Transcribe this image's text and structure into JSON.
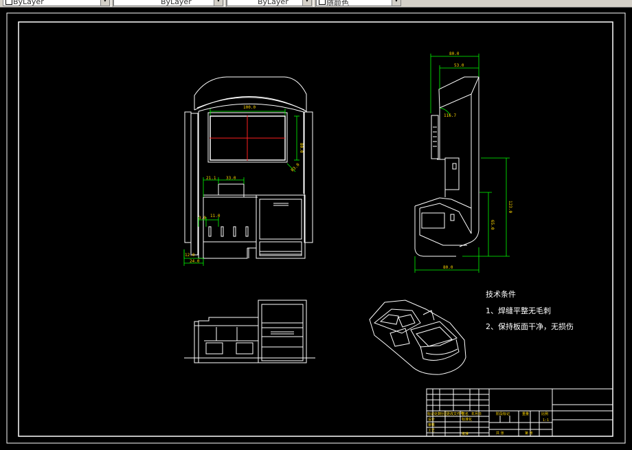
{
  "toolbar": {
    "linetype_value": "ByLayer",
    "lineweight_value": "ByLayer",
    "plotstyle_value": "ByLayer",
    "color_value": "随颜色"
  },
  "dims": {
    "front_width": "100.0",
    "front_height": "80.0",
    "front_chamfer": "R3.0",
    "front_d1": "21.1",
    "front_d2": "33.0",
    "front_d3": "3.0",
    "front_d4": "11.0",
    "front_bottom_h": "12.0",
    "front_bottom_w": "24.0",
    "side_top_outer": "80.0",
    "side_top_inner": "53.0",
    "side_angle": "116.7",
    "side_h_long": "123.0",
    "side_h_short": "65.0",
    "side_bottom": "80.0"
  },
  "notes": {
    "heading": "技术条件",
    "item1": "1、焊缝平整无毛刺",
    "item2": "2、保持板面干净，无损伤"
  },
  "title_block": {
    "r1": [
      "标记",
      "处数",
      "分区",
      "更改文件号",
      "签名",
      "年月日"
    ],
    "r2": [
      "设计",
      "标准化"
    ],
    "r3": [
      "审核"
    ],
    "r4": [
      "工艺",
      "批准"
    ],
    "stage_label": "阶段标记",
    "weight_label": "重量",
    "scale_label": "比例",
    "scale_value": "1:1",
    "sheet_total": "共  张",
    "sheet_num": "第  张"
  },
  "colors": {
    "background": "#000000",
    "outline": "#ffffff",
    "dimension": "#00ff00",
    "dim_text": "#ffd700",
    "centerline": "#ff0000",
    "note_text": "#ffffff"
  }
}
